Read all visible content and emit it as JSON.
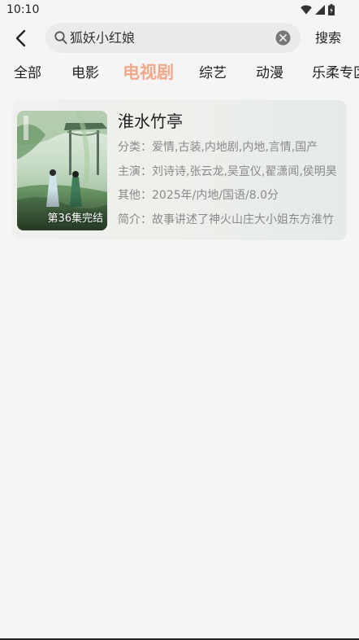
{
  "status_bar": {
    "time": "10:10",
    "icons": [
      "wifi-icon",
      "signal-icon",
      "battery-icon"
    ]
  },
  "header": {
    "back_icon": "chevron-left-icon",
    "search": {
      "value": "狐妖小红娘",
      "icon": "search-icon",
      "clear_icon": "clear-icon"
    },
    "search_button_label": "搜索"
  },
  "tabs": {
    "items": [
      {
        "label": "全部"
      },
      {
        "label": "电影"
      },
      {
        "label": "电视剧",
        "active": true
      },
      {
        "label": "综艺"
      },
      {
        "label": "动漫"
      },
      {
        "label": "乐柔专区"
      }
    ],
    "active_color": "#f2a98a"
  },
  "result": {
    "title": "淮水竹亭",
    "poster_badge": "第36集完结",
    "rows": [
      {
        "key": "分类：",
        "value": "爱情,古装,内地剧,内地,言情,国产"
      },
      {
        "key": "主演：",
        "value": "刘诗诗,张云龙,吴宣仪,翟潇闻,侯明昊"
      },
      {
        "key": "其他：",
        "value": "2025年/内地/国语/8.0分"
      },
      {
        "key": "简介：",
        "value": "故事讲述了神火山庄大小姐东方淮竹"
      }
    ]
  }
}
